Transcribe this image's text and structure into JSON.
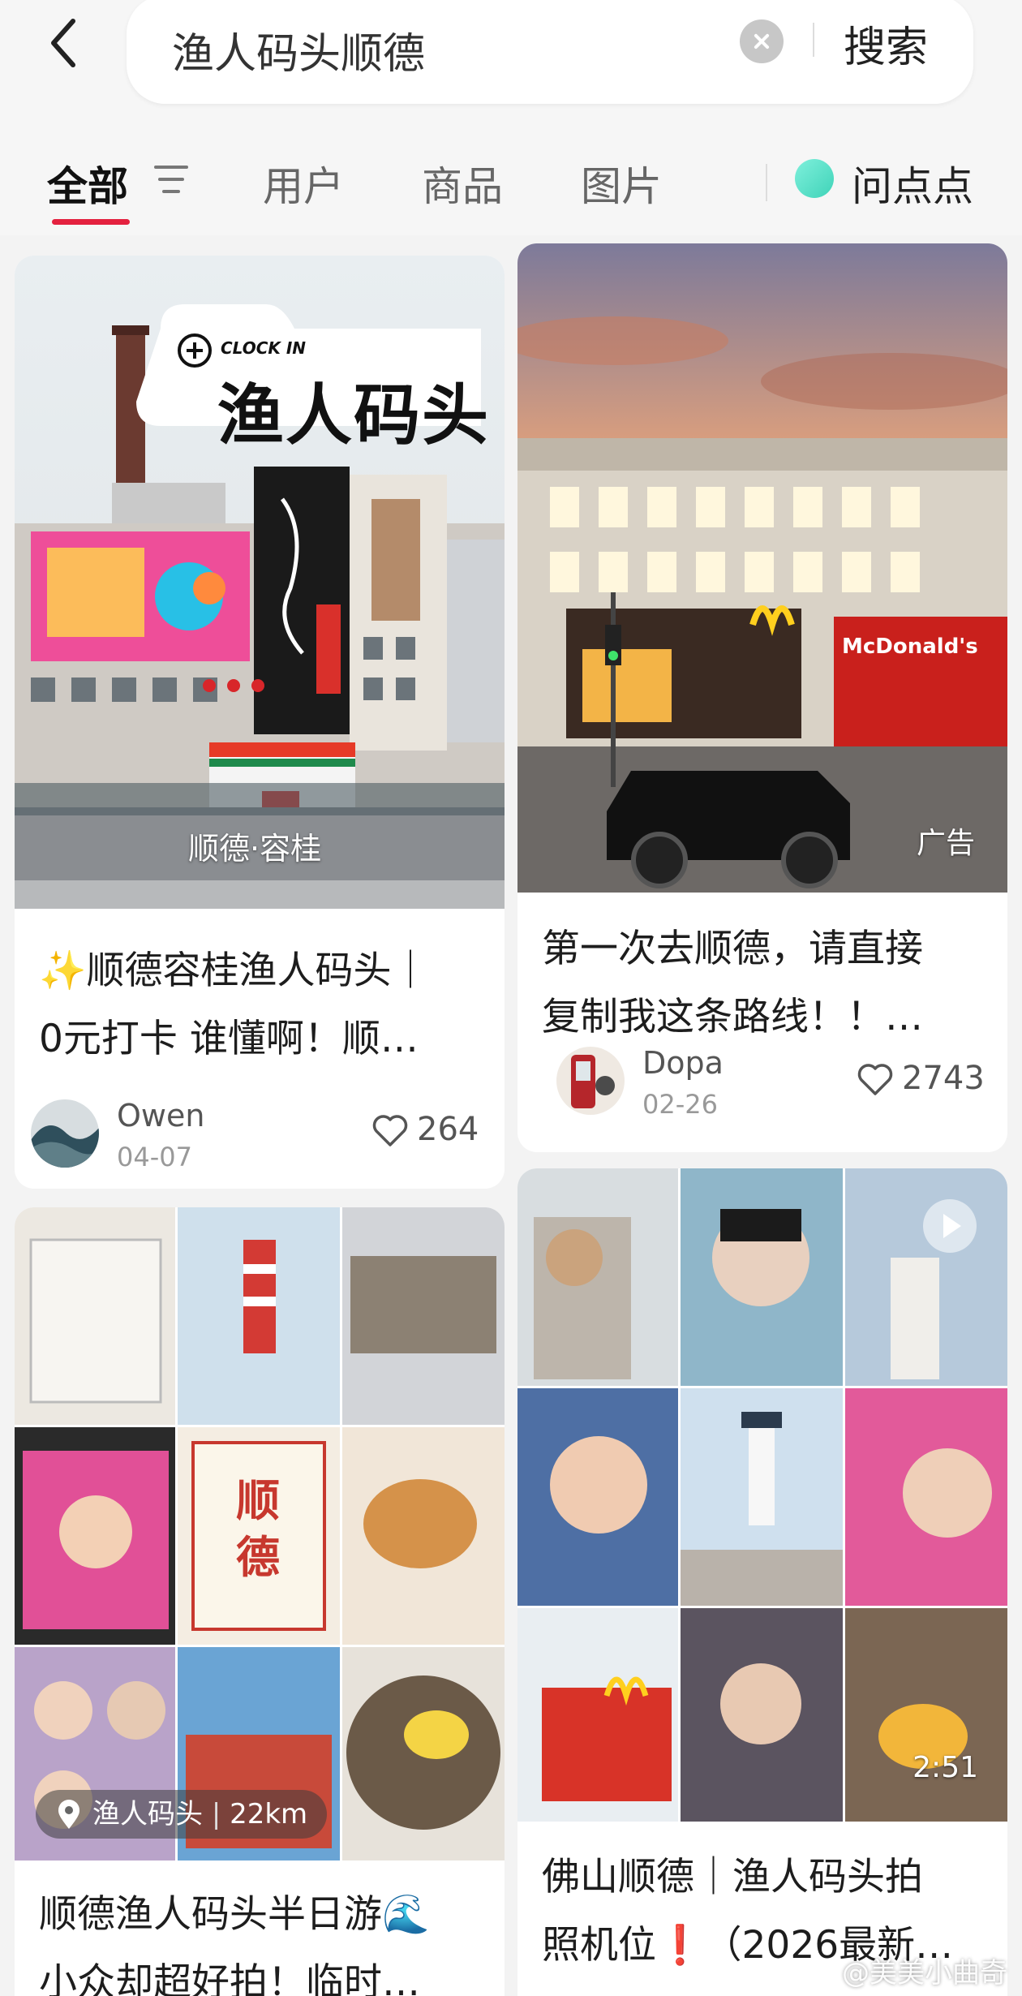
{
  "search": {
    "query": "渔人码头顺德",
    "submit_label": "搜索"
  },
  "tabs": [
    {
      "label": "全部",
      "active": true
    },
    {
      "label": "用户",
      "active": false
    },
    {
      "label": "商品",
      "active": false
    },
    {
      "label": "图片",
      "active": false
    }
  ],
  "ask": {
    "label": "问点点"
  },
  "feed": [
    {
      "title_line1": "✨顺德容桂渔人码头｜",
      "title_line2": "0元打卡 谁懂啊！顺…",
      "cover_badge_small": "CLOCK IN",
      "cover_badge_big": "渔人码头",
      "cover_caption": "顺德·容桂",
      "author": "Owen",
      "date": "04-07",
      "likes": "264"
    },
    {
      "title_line1": "第一次去顺德，请直接",
      "title_line2": "复制我这条路线！！…",
      "cover_tag": "广告",
      "author": "Dopa",
      "date": "02-26",
      "likes": "2743"
    },
    {
      "title_line1": "顺德渔人码头半日游🌊",
      "title_line2": "小众却超好拍！临时…",
      "location": "渔人码头",
      "distance": "22km"
    },
    {
      "title_line1": "佛山顺德｜渔人码头拍",
      "title_line2": "照机位❗️（2026最新…",
      "duration": "2:51"
    }
  ],
  "watermark": "@美美小曲奇",
  "colors": {
    "accent": "#e4213f",
    "page_bg": "#f3f3f3",
    "ask_dot": "#4fdcc3"
  }
}
